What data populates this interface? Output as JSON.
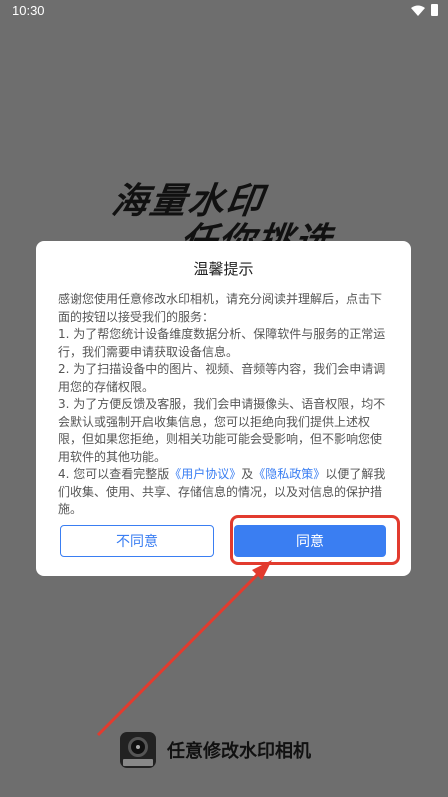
{
  "status_bar": {
    "time": "10:30"
  },
  "splash": {
    "slogan_line1": "海量水印",
    "slogan_line2": "任你挑选",
    "app_name": "任意修改水印相机"
  },
  "dialog": {
    "title": "温馨提示",
    "intro": "感谢您使用任意修改水印相机，请充分阅读并理解后，点击下面的按钮以接受我们的服务：",
    "item1": "1. 为了帮您统计设备维度数据分析、保障软件与服务的正常运行，我们需要申请获取设备信息。",
    "item2": "2. 为了扫描设备中的图片、视频、音频等内容，我们会申请调用您的存储权限。",
    "item3": "3. 为了方便反馈及客服，我们会申请摄像头、语音权限，均不会默认或强制开启收集信息，您可以拒绝向我们提供上述权限，但如果您拒绝，则相关功能可能会受影响，但不影响您使用软件的其他功能。",
    "item4_prefix": "4. 您可以查看完整版",
    "user_agreement_link": "《用户协议》",
    "and": "及",
    "privacy_link": "《隐私政策》",
    "item4_suffix": "以便了解我们收集、使用、共享、存储信息的情况，以及对信息的保护措施。",
    "disagree_label": "不同意",
    "agree_label": "同意"
  },
  "colors": {
    "accent": "#3a7ef2",
    "annotation": "#e23b2e",
    "background": "#6e6e6e"
  }
}
